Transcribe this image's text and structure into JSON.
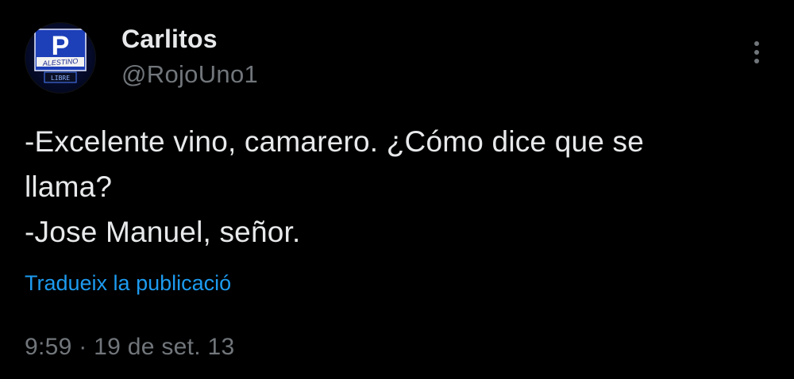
{
  "author": {
    "display_name": "Carlitos",
    "handle": "@RojoUno1",
    "avatar": {
      "sign_letter": "P",
      "sign_text": "ALESTINO",
      "sign_status": "LIBRE"
    }
  },
  "more_icon": "vertical-ellipsis-icon",
  "tweet": {
    "lines": [
      "-Excelente vino, camarero. ¿Cómo dice que se",
      "llama?",
      "-Jose Manuel, señor."
    ],
    "translate_label": "Tradueix la publicació",
    "timestamp": "9:59 · 19 de set. 13"
  },
  "colors": {
    "background": "#000000",
    "primary_text": "#e7e9ea",
    "secondary_text": "#71767b",
    "link": "#1d9bf0"
  }
}
